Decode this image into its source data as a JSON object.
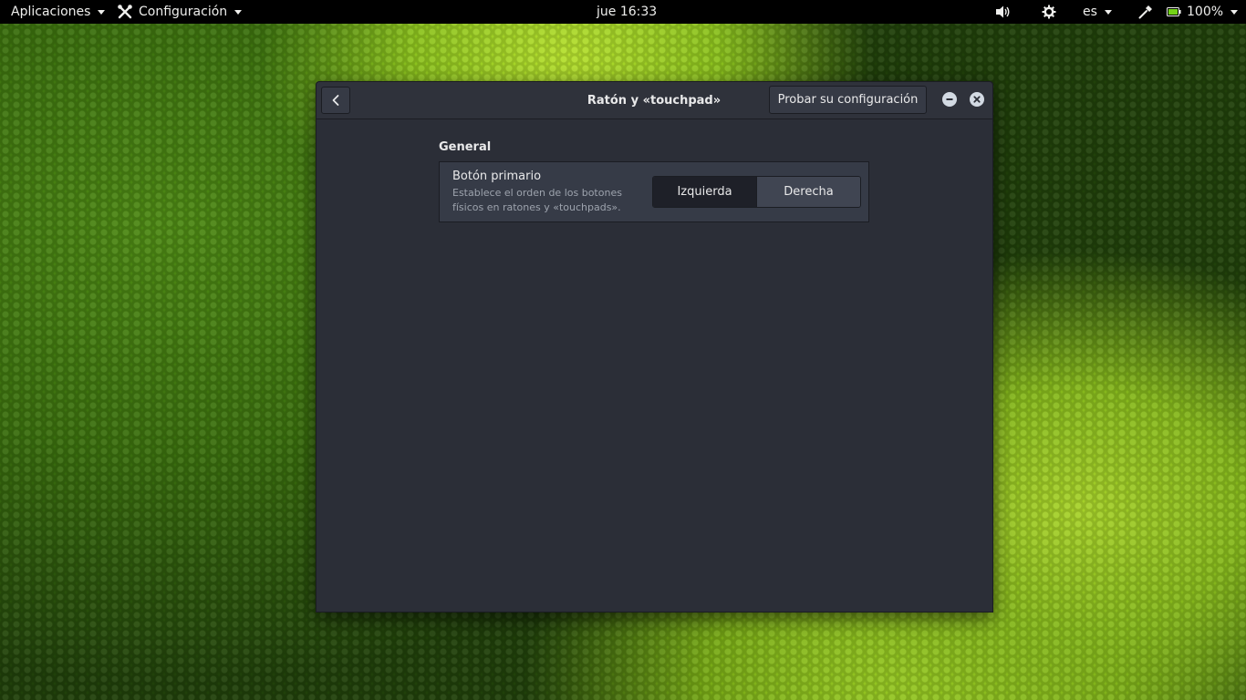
{
  "topbar": {
    "apps_label": "Aplicaciones",
    "app_menu_label": "Configuración",
    "clock": "jue 16:33",
    "keyboard_layout": "es",
    "battery": "100%"
  },
  "window": {
    "title": "Ratón y «touchpad»",
    "test_button": "Probar su configuración",
    "section_label": "General",
    "primary_button": {
      "title": "Botón primario",
      "description": "Establece el orden de los botones físicos en ratones y «touchpads».",
      "options": [
        "Izquierda",
        "Derecha"
      ],
      "selected": "Izquierda"
    }
  },
  "colors": {
    "window_bg": "#2b2e37",
    "headerbar_bg": "#2f323b",
    "row_bg": "#363b47",
    "active_segment": "#1e2028",
    "topbar_bg": "#000000"
  }
}
